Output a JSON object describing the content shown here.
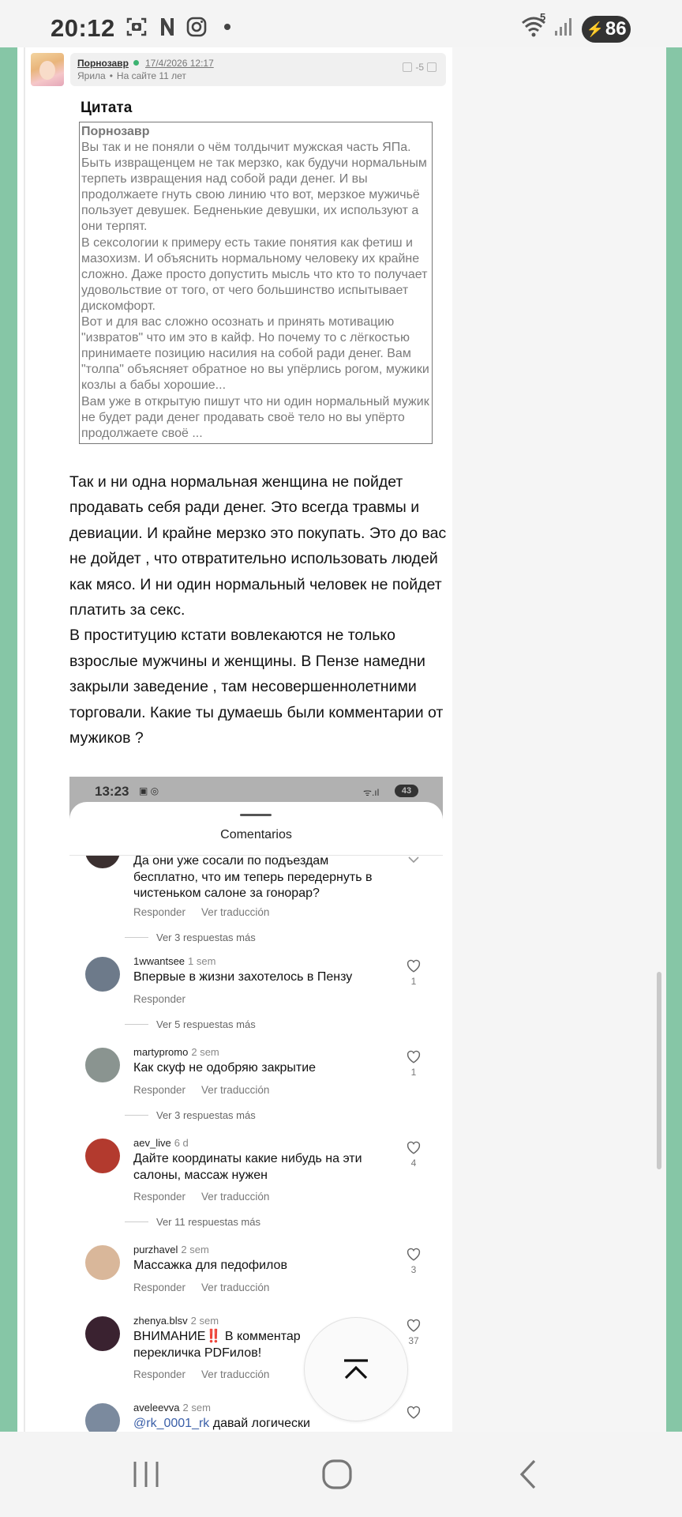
{
  "status_bar": {
    "time": "20:12",
    "icons": [
      "screenshot-icon",
      "n-icon",
      "instagram-icon",
      "dot-icon"
    ],
    "wifi_badge": "5",
    "battery": "86"
  },
  "post": {
    "author": "Порнозавр",
    "date": "17/4/2026 12:17",
    "meta_name": "Ярила",
    "meta_site": "На сайте 11 лет",
    "vote": "-5"
  },
  "quote": {
    "title": "Цитата",
    "author": "Порнозавр",
    "text": "Вы так и не поняли о чём толдычит мужская часть ЯПа. Быть извращенцем не так мерзко, как будучи нормальным терпеть извращения над собой ради денег. И вы продолжаете гнуть свою линию что вот, мерзкое мужичьё пользует девушек. Бедненькие девушки, их используют а они терпят.\nВ сексологии к примеру есть такие понятия как фетиш и мазохизм. И объяснить нормальному человеку их крайне сложно. Даже просто допустить мысль что кто то получает удовольствие от того, от чего большинство испытывает дискомфорт.\nВот и для вас сложно осознать и принять мотивацию \"извратов\" что им это в кайф. Но почему то с лёгкостью принимаете позицию насилия на собой ради денег. Вам \"толпа\" объясняет обратное но вы упёрлись рогом, мужики козлы а бабы хорошие...\nВам уже в открытую пишут что ни один нормальный мужик не будет ради денег продавать своё тело но вы упёрто продолжаете своё ..."
  },
  "body": "Так и ни одна нормальная женщина не пойдет продавать себя ради денег. Это всегда травмы и девиации. И крайне мерзко это покупать. Это до вас не дойдет , что отвратительно использовать людей как мясо. И ни один нормальный человек не пойдет платить за секс.\nВ проституцию кстати вовлекаются не только взрослые мужчины и женщины. В Пензе намедни закрыли заведение , там несовершеннолетними торговали. Какие ты думаешь были комментарии от мужиков ?",
  "embedded": {
    "time": "13:23",
    "battery": "43",
    "sheet_title": "Comentarios",
    "first_comment": {
      "text": "Да они уже сосали по подъездам бесплатно, что им теперь передернуть в чистеньком салоне за гонорар?",
      "reply": "Responder",
      "translate": "Ver traducción",
      "more": "Ver 3 respuestas más"
    },
    "comments": [
      {
        "user": "1wwantsee",
        "time": "1 sem",
        "text": "Впервые в жизни захотелось в Пензу",
        "reply": "Responder",
        "translate": "",
        "likes": "1",
        "more": "Ver 5 respuestas más",
        "avatar_color": "#6d7a8a"
      },
      {
        "user": "martypromo",
        "time": "2 sem",
        "text": "Как скуф не одобряю закрытие",
        "reply": "Responder",
        "translate": "Ver traducción",
        "likes": "1",
        "more": "Ver 3 respuestas más",
        "avatar_color": "#8a9490"
      },
      {
        "user": "aev_live",
        "time": "6 d",
        "text": "Дайте координаты какие нибудь на эти салоны, массаж нужен",
        "reply": "Responder",
        "translate": "Ver traducción",
        "likes": "4",
        "more": "Ver 11 respuestas más",
        "avatar_color": "#b33a2e"
      },
      {
        "user": "purzhavel",
        "time": "2 sem",
        "text": "Массажка для педофилов",
        "reply": "Responder",
        "translate": "Ver traducción",
        "likes": "3",
        "more": "",
        "avatar_color": "#d9b79a"
      },
      {
        "user": "zhenya.blsv",
        "time": "2 sem",
        "text": "ВНИМАНИЕ‼️ В комментар\nперекличка PDFилов!",
        "reply": "Responder",
        "translate": "Ver traducción",
        "likes": "37",
        "more": "",
        "avatar_color": "#3a2230"
      },
      {
        "user": "aveleevva",
        "time": "2 sem",
        "text": "@rk_0001_rk давай логически",
        "reply": "",
        "translate": "",
        "likes": "",
        "more": "",
        "avatar_color": "#7b8a9e"
      }
    ]
  },
  "navigation": {
    "recents": "recents-icon",
    "home": "home-icon",
    "back": "back-icon"
  }
}
